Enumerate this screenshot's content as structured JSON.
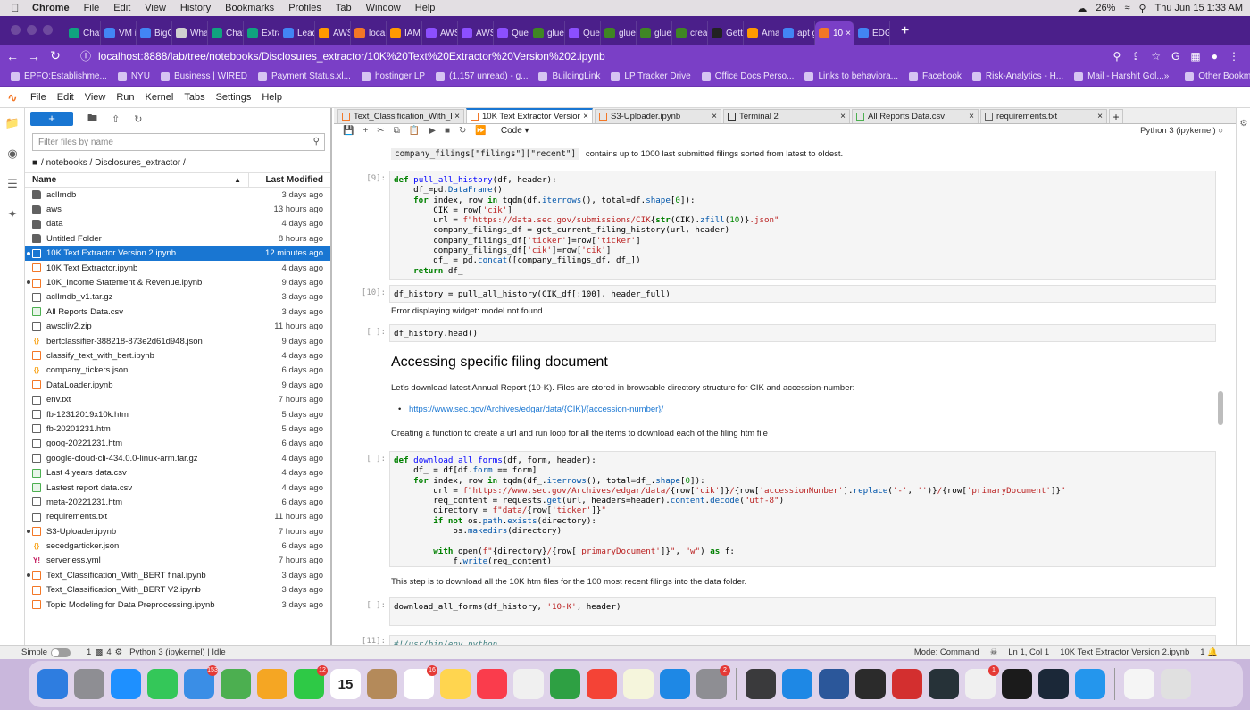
{
  "macmenu": {
    "app": "Chrome",
    "items": [
      "File",
      "Edit",
      "View",
      "History",
      "Bookmarks",
      "Profiles",
      "Tab",
      "Window",
      "Help"
    ],
    "battery": "26%",
    "datetime": "Thu Jun 15  1:33 AM"
  },
  "chrome_tabs": [
    {
      "label": "ChatG",
      "color": "#10a37f"
    },
    {
      "label": "VM in",
      "color": "#4285f4"
    },
    {
      "label": "BigQu",
      "color": "#4285f4"
    },
    {
      "label": "What",
      "color": "#d0d0d0"
    },
    {
      "label": "ChatG",
      "color": "#10a37f"
    },
    {
      "label": "Extra",
      "color": "#10a37f"
    },
    {
      "label": "Leade",
      "color": "#4285f4"
    },
    {
      "label": "AWS",
      "color": "#ff9900"
    },
    {
      "label": "localh",
      "color": "#f37726"
    },
    {
      "label": "IAM M",
      "color": "#ff9900"
    },
    {
      "label": "AWS",
      "color": "#8c4fff"
    },
    {
      "label": "AWS",
      "color": "#8c4fff"
    },
    {
      "label": "Query",
      "color": "#8c4fff"
    },
    {
      "label": "glue-c",
      "color": "#3f8624"
    },
    {
      "label": "Query",
      "color": "#8c4fff"
    },
    {
      "label": "glue-c",
      "color": "#3f8624"
    },
    {
      "label": "glue-c",
      "color": "#3f8624"
    },
    {
      "label": "creat",
      "color": "#3f8624"
    },
    {
      "label": "Gettir",
      "color": "#222222"
    },
    {
      "label": "Amaz",
      "color": "#ff9900"
    },
    {
      "label": "apt g",
      "color": "#4285f4"
    },
    {
      "label": "10",
      "color": "#f37726",
      "active": true
    },
    {
      "label": "EDGA",
      "color": "#4285f4"
    }
  ],
  "url": "localhost:8888/lab/tree/notebooks/Disclosures_extractor/10K%20Text%20Extractor%20Version%202.ipynb",
  "bookmarks": [
    "EPFO:Establishme...",
    "NYU",
    "Business | WIRED",
    "Payment Status.xl...",
    "hostinger LP",
    "(1,157 unread) - g...",
    "BuildingLink",
    "LP Tracker Drive",
    "Office Docs Perso...",
    "Links to behaviora...",
    "Facebook",
    "Risk-Analytics - H...",
    "Mail - Harshit Gol..."
  ],
  "other_bookmarks": "Other Bookmarks",
  "jupyter_menu": [
    "File",
    "Edit",
    "View",
    "Run",
    "Kernel",
    "Tabs",
    "Settings",
    "Help"
  ],
  "filebrowser": {
    "filter_placeholder": "Filter files by name",
    "breadcrumb": "/ notebooks / Disclosures_extractor /",
    "col_name": "Name",
    "col_modified": "Last Modified",
    "files": [
      {
        "name": "aclImdb",
        "modified": "3 days ago",
        "type": "folder"
      },
      {
        "name": "aws",
        "modified": "13 hours ago",
        "type": "folder"
      },
      {
        "name": "data",
        "modified": "4 days ago",
        "type": "folder"
      },
      {
        "name": "Untitled Folder",
        "modified": "8 hours ago",
        "type": "folder"
      },
      {
        "name": "10K Text Extractor Version 2.ipynb",
        "modified": "12 minutes ago",
        "type": "nb",
        "running": true,
        "selected": true
      },
      {
        "name": "10K Text Extractor.ipynb",
        "modified": "4 days ago",
        "type": "nb"
      },
      {
        "name": "10K_Income Statement & Revenue.ipynb",
        "modified": "9 days ago",
        "type": "nb",
        "running": true
      },
      {
        "name": "aclImdb_v1.tar.gz",
        "modified": "3 days ago",
        "type": "file"
      },
      {
        "name": "All Reports Data.csv",
        "modified": "3 days ago",
        "type": "csv"
      },
      {
        "name": "awscliv2.zip",
        "modified": "11 hours ago",
        "type": "file"
      },
      {
        "name": "bertclassifier-388218-873e2d61d948.json",
        "modified": "9 days ago",
        "type": "json"
      },
      {
        "name": "classify_text_with_bert.ipynb",
        "modified": "4 days ago",
        "type": "nb"
      },
      {
        "name": "company_tickers.json",
        "modified": "6 days ago",
        "type": "json"
      },
      {
        "name": "DataLoader.ipynb",
        "modified": "9 days ago",
        "type": "nb"
      },
      {
        "name": "env.txt",
        "modified": "7 hours ago",
        "type": "file"
      },
      {
        "name": "fb-12312019x10k.htm",
        "modified": "5 days ago",
        "type": "file"
      },
      {
        "name": "fb-20201231.htm",
        "modified": "5 days ago",
        "type": "file"
      },
      {
        "name": "goog-20221231.htm",
        "modified": "6 days ago",
        "type": "file"
      },
      {
        "name": "google-cloud-cli-434.0.0-linux-arm.tar.gz",
        "modified": "4 days ago",
        "type": "file"
      },
      {
        "name": "Last 4 years data.csv",
        "modified": "4 days ago",
        "type": "csv"
      },
      {
        "name": "Lastest report data.csv",
        "modified": "4 days ago",
        "type": "csv"
      },
      {
        "name": "meta-20221231.htm",
        "modified": "6 days ago",
        "type": "file"
      },
      {
        "name": "requirements.txt",
        "modified": "11 hours ago",
        "type": "file"
      },
      {
        "name": "S3-Uploader.ipynb",
        "modified": "7 hours ago",
        "type": "nb",
        "running": true
      },
      {
        "name": "secedgarticker.json",
        "modified": "6 days ago",
        "type": "json"
      },
      {
        "name": "serverless.yml",
        "modified": "7 hours ago",
        "type": "yml"
      },
      {
        "name": "Text_Classification_With_BERT final.ipynb",
        "modified": "3 days ago",
        "type": "nb",
        "running": true
      },
      {
        "name": "Text_Classification_With_BERT V2.ipynb",
        "modified": "3 days ago",
        "type": "nb"
      },
      {
        "name": "Topic Modeling for Data Preprocessing.ipynb",
        "modified": "3 days ago",
        "type": "nb"
      }
    ]
  },
  "doc_tabs": [
    {
      "label": "Text_Classification_With_B",
      "type": "nb"
    },
    {
      "label": "10K Text Extractor Version",
      "type": "nb",
      "active": true
    },
    {
      "label": "S3-Uploader.ipynb",
      "type": "nb"
    },
    {
      "label": "Terminal 2",
      "type": "term"
    },
    {
      "label": "All Reports Data.csv",
      "type": "csv"
    },
    {
      "label": "requirements.txt",
      "type": "file"
    }
  ],
  "notebook": {
    "cell_type": "Code",
    "kernel": "Python 3 (ipykernel)",
    "intro_code": "company_filings[\"filings\"][\"recent\"]",
    "intro_text": "contains up to 1000 last submitted filings sorted from latest to oldest.",
    "prompt9": "[9]:",
    "prompt10": "[10]:",
    "prompt_empty": "[ ]:",
    "prompt_partial": "[11]:",
    "cell10_code": "df_history = pull_all_history(CIK_df[:100], header_full)",
    "cell10_output": "Error displaying widget: model not found",
    "cell_head": "df_history.head()",
    "heading": "Accessing specific filing document",
    "para1": "Let's download latest Annual Report (10-K). Files are stored in browsable directory structure for CIK and accession-number:",
    "link": "https://www.sec.gov/Archives/edgar/data/{CIK}/{accession-number}/",
    "para2": "Creating a function to create a url and run loop for all the items to download each of the filing htm file",
    "para3": "This step is to download all the 10K htm files for the 100 most recent filings into the data folder.",
    "cell_dl_call": "download_all_forms(df_history, '10-K', header)",
    "partial_code": "#!/usr/bin/env python"
  },
  "statusbar": {
    "mode_label": "Simple",
    "terminals": "1",
    "kernels": "4",
    "kernel_status": "Python 3 (ipykernel) | Idle",
    "mode": "Mode: Command",
    "position": "Ln 1, Col 1",
    "file": "10K Text Extractor Version 2.ipynb",
    "page": "1"
  },
  "dock": [
    {
      "name": "finder",
      "color": "#2e7de0"
    },
    {
      "name": "launchpad",
      "color": "#8e8e93"
    },
    {
      "name": "safari",
      "color": "#1e90ff"
    },
    {
      "name": "messages",
      "color": "#34c759"
    },
    {
      "name": "mail",
      "color": "#3a8ee6",
      "badge": "153"
    },
    {
      "name": "maps",
      "color": "#4caf50"
    },
    {
      "name": "photos",
      "color": "#f5a623"
    },
    {
      "name": "facetime",
      "color": "#2ec946",
      "badge": "12"
    },
    {
      "name": "calendar",
      "color": "#ffffff",
      "text": "15"
    },
    {
      "name": "contacts",
      "color": "#b48a5a"
    },
    {
      "name": "reminders",
      "color": "#ffffff",
      "badge": "16"
    },
    {
      "name": "notes",
      "color": "#ffd54f"
    },
    {
      "name": "music",
      "color": "#fa3c4c"
    },
    {
      "name": "news",
      "color": "#f0f0f0"
    },
    {
      "name": "numbers",
      "color": "#2ea043"
    },
    {
      "name": "chrome",
      "color": "#f44336"
    },
    {
      "name": "textedit",
      "color": "#f5f5dc"
    },
    {
      "name": "appstore",
      "color": "#1e88e5"
    },
    {
      "name": "systemsettings",
      "color": "#8e8e93",
      "badge": "2"
    },
    {
      "name": "calculator",
      "color": "#3a3a3c"
    },
    {
      "name": "vscode",
      "color": "#1e88e5"
    },
    {
      "name": "word",
      "color": "#2b579a"
    },
    {
      "name": "terminal",
      "color": "#2b2b2b"
    },
    {
      "name": "acrobat",
      "color": "#d32f2f"
    },
    {
      "name": "activitymonitor",
      "color": "#263238"
    },
    {
      "name": "microsoft",
      "color": "#f0f0f0",
      "badge": "1"
    },
    {
      "name": "pycharm",
      "color": "#1b1b1b"
    },
    {
      "name": "steam",
      "color": "#1b2838"
    },
    {
      "name": "docker",
      "color": "#2496ed"
    },
    {
      "name": "downloads",
      "color": "#f5f5f5"
    },
    {
      "name": "trash",
      "color": "#e0e0e0"
    }
  ]
}
